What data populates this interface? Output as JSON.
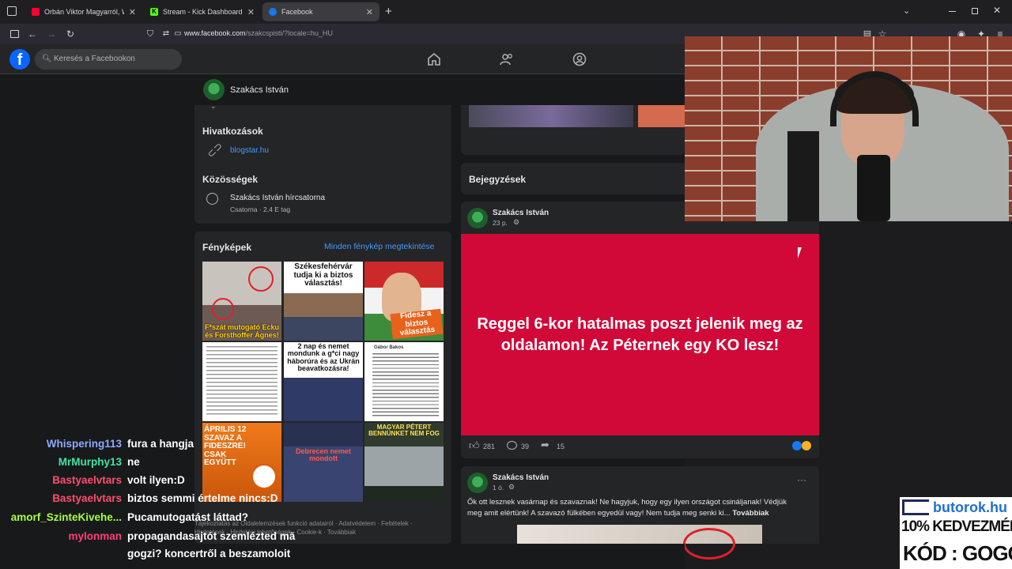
{
  "browser": {
    "tabs": [
      {
        "title": "Orbán Viktor Magyarról, Wäber",
        "favicon_color": "#ff0033",
        "active": false
      },
      {
        "title": "Stream - Kick Dashboard",
        "favicon_color": "#53fc18",
        "active": false
      },
      {
        "title": "Facebook",
        "favicon_color": "#1877f2",
        "active": true
      }
    ],
    "new_tab": "+",
    "url_host": "www.facebook.com",
    "url_path": "/szakcspisti/?locale=hu_HU"
  },
  "facebook": {
    "logo": "f",
    "search_placeholder": "Keresés a Facebookon",
    "nav_icons": [
      "home-icon",
      "friends-icon",
      "groups-icon"
    ],
    "profile_name": "Szakács István",
    "links_section": {
      "title": "Hivatkozások",
      "url": "blogstar.hu"
    },
    "communities_section": {
      "title": "Közösségek",
      "name": "Szakács István hírcsatorna",
      "meta": "Csatorna · 2,4 E tag"
    },
    "photos": {
      "title": "Fényképek",
      "see_all": "Minden fénykép megtekintése",
      "captions": [
        "F*szát mutogató Ecku és Forsthoffer Ágnes!",
        "Székesfehérvár tudja ki a biztos választás!",
        "Fidesz a biztos választás",
        "",
        "2 nap és nemet mondunk a g*ci nagy háborúra és az Ukrán beavatkozásra!",
        "",
        "ÁPRILIS 12 SZAVAZ A FIDESZRE! CSAK EGYÜTT",
        "Debrecen nemet mondott",
        "MAGYAR PÉTERT BENNÜNKET NEM FOG"
      ],
      "text_tile_author": "Gábor Bakos"
    },
    "footer": "Tájékoztatás az Oldalelemzések funkció adatairól · Adatvédelem · Feltételek · Hirdetések · Hirdetési lehetőségek · Cookie-k · Továbbiak",
    "posts_section_title": "Bejegyzések",
    "posts": [
      {
        "author": "Szakács István",
        "time": "23 p.",
        "image_text": "Reggel 6-kor hatalmas poszt jelenik meg az oldalamon! Az Péternek egy KO lesz!",
        "likes": "281",
        "comments": "39",
        "shares": "15",
        "image_color": "#d10938"
      },
      {
        "author": "Szakács István",
        "time": "1 ó.",
        "text": "Ők ott lesznek vasárnap és szavaznak! Ne hagyjuk, hogy egy ilyen országot csináljanak! Védjük meg amit elértünk! A szavazó fülkében egyedül vagy! Nem tudja meg senki ki...",
        "more": "Továbbiak",
        "menu": "···"
      }
    ]
  },
  "chat": [
    {
      "user": "Whispering113",
      "color": "#8fa8ff",
      "message": "fura a hangja"
    },
    {
      "user": "MrMurphy13",
      "color": "#3ee6a4",
      "message": "ne"
    },
    {
      "user": "Bastyaelvtars",
      "color": "#ff4d6d",
      "message": "volt ilyen:D"
    },
    {
      "user": "Bastyaelvtars",
      "color": "#ff4d6d",
      "message": "biztos semmi értelme nincs:D"
    },
    {
      "user": "amorf_SzinteKivehe...",
      "color": "#a6ff3e",
      "message": "Pucamutogatást láttad?"
    },
    {
      "user": "mylonman",
      "color": "#ff3d7a",
      "message": "propagandasajtót szemlézted mā"
    },
    {
      "user": "",
      "color": "#ffffff",
      "message": "gogzi? koncertről a beszamoloit"
    }
  ],
  "ad": {
    "site": "butorok.hu",
    "line1": "10% KEDVEZMÉNY",
    "line2": "KÓD : GOGGER"
  }
}
